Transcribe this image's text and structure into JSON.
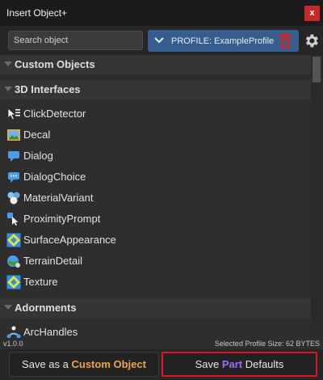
{
  "window": {
    "title": "Insert Object+",
    "close_label": "x"
  },
  "toolbar": {
    "search_placeholder": "Search object",
    "profile_label": "PROFILE: ExampleProfile"
  },
  "sections": [
    {
      "label": "Custom Objects"
    },
    {
      "label": "3D Interfaces"
    },
    {
      "label": "Adornments"
    }
  ],
  "items": [
    {
      "label": "ClickDetector",
      "icon": "click-detector-icon"
    },
    {
      "label": "Decal",
      "icon": "decal-icon"
    },
    {
      "label": "Dialog",
      "icon": "dialog-icon"
    },
    {
      "label": "DialogChoice",
      "icon": "dialog-choice-icon"
    },
    {
      "label": "MaterialVariant",
      "icon": "material-variant-icon"
    },
    {
      "label": "ProximityPrompt",
      "icon": "proximity-prompt-icon"
    },
    {
      "label": "SurfaceAppearance",
      "icon": "surface-appearance-icon"
    },
    {
      "label": "TerrainDetail",
      "icon": "terrain-detail-icon"
    },
    {
      "label": "Texture",
      "icon": "texture-icon"
    },
    {
      "label": "ArcHandles",
      "icon": "arc-handles-icon"
    }
  ],
  "status": {
    "version": "v1.0.0",
    "profile_size": "Selected Profile Size: 62 BYTES"
  },
  "footer": {
    "save_custom_prefix": "Save as a ",
    "save_custom_accent": "Custom Object",
    "save_defaults_prefix": "Save ",
    "save_defaults_accent": "Part",
    "save_defaults_suffix": " Defaults"
  },
  "colors": {
    "profile_bg": "#365d8e",
    "close_bg": "#c5272b",
    "accent_orange": "#f0a44a",
    "accent_purple": "#9d6cf0",
    "highlight_border": "#e3131f"
  }
}
